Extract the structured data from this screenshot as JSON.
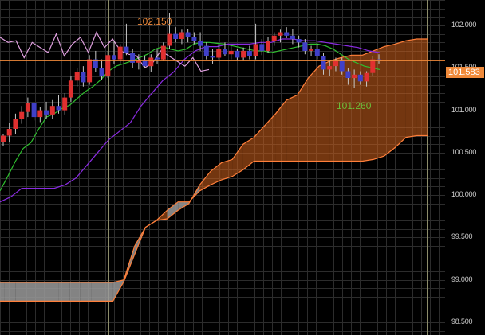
{
  "chart_data": {
    "type": "candlestick",
    "ylim": [
      98.35,
      102.3
    ],
    "y_ticks": [
      "102.000",
      "101.500",
      "101.000",
      "100.500",
      "100.000",
      "99.500",
      "99.000",
      "98.500"
    ],
    "y_tick_values": [
      102.0,
      101.5,
      101.0,
      100.5,
      100.0,
      99.5,
      99.0,
      98.5
    ],
    "grid": true,
    "current_price": "101.583",
    "current_price_value": 101.583,
    "annotations": [
      {
        "text": "102.150",
        "value": 102.15,
        "color": "#f08a3a"
      },
      {
        "text": "101.260",
        "value": 101.26,
        "color": "#6cbf3a"
      }
    ],
    "colors": {
      "up": "#e03030",
      "down": "#4040c8",
      "tenkan": "#2fbf2f",
      "kijun": "#8a2be2",
      "chikou": "#e0a0e0",
      "cloud_bull": "#d2621d",
      "cloud_bear": "#9a9a9a",
      "span_edge": "#ff7f3a",
      "price_line": "#f08a3a",
      "grid": "#2c2c2c",
      "vline": "#8c8c6a"
    },
    "candles": [
      [
        100.62,
        100.72,
        100.58,
        100.7
      ],
      [
        100.7,
        100.85,
        100.62,
        100.78
      ],
      [
        100.78,
        100.96,
        100.72,
        100.9
      ],
      [
        100.9,
        101.05,
        100.84,
        100.98
      ],
      [
        100.98,
        101.15,
        100.92,
        101.08
      ],
      [
        101.08,
        101.05,
        100.88,
        100.92
      ],
      [
        100.92,
        101.04,
        100.86,
        101.0
      ],
      [
        101.0,
        101.1,
        100.9,
        100.95
      ],
      [
        100.95,
        101.12,
        100.9,
        101.05
      ],
      [
        101.05,
        101.18,
        100.96,
        101.0
      ],
      [
        101.0,
        101.2,
        100.95,
        101.15
      ],
      [
        101.15,
        101.4,
        101.1,
        101.35
      ],
      [
        101.35,
        101.5,
        101.28,
        101.45
      ],
      [
        101.45,
        101.52,
        101.28,
        101.33
      ],
      [
        101.33,
        101.65,
        101.3,
        101.6
      ],
      [
        101.6,
        101.7,
        101.45,
        101.5
      ],
      [
        101.5,
        101.6,
        101.36,
        101.4
      ],
      [
        101.4,
        101.7,
        101.38,
        101.65
      ],
      [
        101.65,
        101.82,
        101.55,
        101.6
      ],
      [
        101.6,
        101.78,
        101.55,
        101.75
      ],
      [
        101.75,
        102.02,
        101.65,
        101.68
      ],
      [
        101.68,
        101.72,
        101.5,
        101.56
      ],
      [
        101.56,
        101.66,
        101.48,
        101.58
      ],
      [
        101.58,
        101.64,
        101.5,
        101.52
      ],
      [
        101.52,
        101.66,
        101.45,
        101.62
      ],
      [
        101.62,
        101.72,
        101.55,
        101.6
      ],
      [
        101.6,
        101.8,
        101.58,
        101.76
      ],
      [
        101.76,
        102.15,
        101.72,
        101.9
      ],
      [
        101.9,
        101.98,
        101.8,
        101.84
      ],
      [
        101.84,
        101.95,
        101.78,
        101.92
      ],
      [
        101.92,
        101.96,
        101.8,
        101.86
      ],
      [
        101.86,
        101.92,
        101.78,
        101.82
      ],
      [
        101.82,
        101.92,
        101.7,
        101.76
      ],
      [
        101.76,
        101.8,
        101.6,
        101.64
      ],
      [
        101.64,
        101.72,
        101.55,
        101.62
      ],
      [
        101.62,
        101.78,
        101.6,
        101.72
      ],
      [
        101.72,
        101.8,
        101.64,
        101.66
      ],
      [
        101.66,
        101.76,
        101.6,
        101.7
      ],
      [
        101.7,
        101.72,
        101.58,
        101.62
      ],
      [
        101.62,
        101.74,
        101.58,
        101.7
      ],
      [
        101.7,
        101.76,
        101.6,
        101.64
      ],
      [
        101.64,
        102.02,
        101.6,
        101.78
      ],
      [
        101.78,
        101.84,
        101.65,
        101.7
      ],
      [
        101.7,
        101.86,
        101.68,
        101.82
      ],
      [
        101.82,
        101.92,
        101.76,
        101.88
      ],
      [
        101.88,
        101.95,
        101.8,
        101.92
      ],
      [
        101.92,
        101.98,
        101.85,
        101.88
      ],
      [
        101.88,
        101.96,
        101.78,
        101.84
      ],
      [
        101.84,
        101.88,
        101.74,
        101.8
      ],
      [
        101.8,
        101.84,
        101.66,
        101.7
      ],
      [
        101.7,
        101.76,
        101.64,
        101.72
      ],
      [
        101.72,
        101.78,
        101.6,
        101.64
      ],
      [
        101.64,
        101.68,
        101.42,
        101.48
      ],
      [
        101.48,
        101.58,
        101.4,
        101.52
      ],
      [
        101.52,
        101.62,
        101.46,
        101.58
      ],
      [
        101.58,
        101.62,
        101.42,
        101.46
      ],
      [
        101.46,
        101.5,
        101.3,
        101.38
      ],
      [
        101.38,
        101.48,
        101.26,
        101.42
      ],
      [
        101.42,
        101.46,
        101.3,
        101.34
      ],
      [
        101.34,
        101.46,
        101.28,
        101.44
      ],
      [
        101.44,
        101.64,
        101.4,
        101.6
      ],
      [
        101.6,
        101.66,
        101.55,
        101.58
      ]
    ],
    "tenkan": [
      100.05,
      100.22,
      100.4,
      100.55,
      100.62,
      100.78,
      100.92,
      100.96,
      101.02,
      101.06,
      101.14,
      101.22,
      101.28,
      101.36,
      101.46,
      101.52,
      101.55,
      101.58,
      101.62,
      101.66,
      101.72,
      101.75,
      101.72,
      101.7,
      101.72,
      101.78,
      101.8,
      101.8,
      101.79,
      101.78,
      101.76,
      101.74,
      101.72,
      101.7,
      101.7,
      101.68,
      101.7,
      101.72,
      101.74,
      101.76,
      101.78,
      101.78,
      101.76,
      101.72,
      101.66,
      101.6,
      101.56,
      101.52,
      101.5,
      101.48
    ],
    "kijun": [
      99.92,
      99.98,
      100.08,
      100.08,
      100.08,
      100.08,
      100.12,
      100.2,
      100.35,
      100.5,
      100.65,
      100.75,
      100.85,
      101.05,
      101.2,
      101.35,
      101.45,
      101.6,
      101.7,
      101.75,
      101.75,
      101.78,
      101.78,
      101.78,
      101.8,
      101.8,
      101.84,
      101.84,
      101.82,
      101.82,
      101.8,
      101.78,
      101.76,
      101.74,
      101.7,
      101.68
    ],
    "chikou": [
      101.86,
      101.8,
      101.82,
      101.62,
      101.8,
      101.74,
      101.68,
      101.9,
      101.64,
      101.78,
      101.86,
      101.68,
      101.92,
      101.74,
      101.84,
      101.7,
      101.66,
      101.64,
      101.5,
      101.56,
      101.7,
      101.64,
      101.58,
      101.52,
      101.62,
      101.46,
      101.48
    ],
    "span_a": [
      98.75,
      98.75,
      98.75,
      98.75,
      98.75,
      98.75,
      98.75,
      98.75,
      98.75,
      98.75,
      98.75,
      98.75,
      98.98,
      99.3,
      99.62,
      99.7,
      99.72,
      99.82,
      99.9,
      100.12,
      100.28,
      100.38,
      100.42,
      100.6,
      100.68,
      100.82,
      100.96,
      101.12,
      101.18,
      101.38,
      101.52,
      101.58,
      101.62,
      101.65,
      101.65,
      101.7,
      101.75,
      101.78,
      101.82,
      101.84,
      101.84
    ],
    "span_b": [
      98.97,
      98.97,
      98.97,
      98.97,
      98.97,
      98.97,
      98.97,
      98.97,
      98.97,
      98.97,
      98.97,
      98.97,
      99.0,
      99.4,
      99.62,
      99.7,
      99.82,
      99.92,
      99.92,
      100.05,
      100.12,
      100.18,
      100.22,
      100.3,
      100.4,
      100.4,
      100.4,
      100.4,
      100.4,
      100.4,
      100.4,
      100.4,
      100.4,
      100.4,
      100.4,
      100.42,
      100.46,
      100.56,
      100.68,
      100.7,
      100.7
    ]
  }
}
